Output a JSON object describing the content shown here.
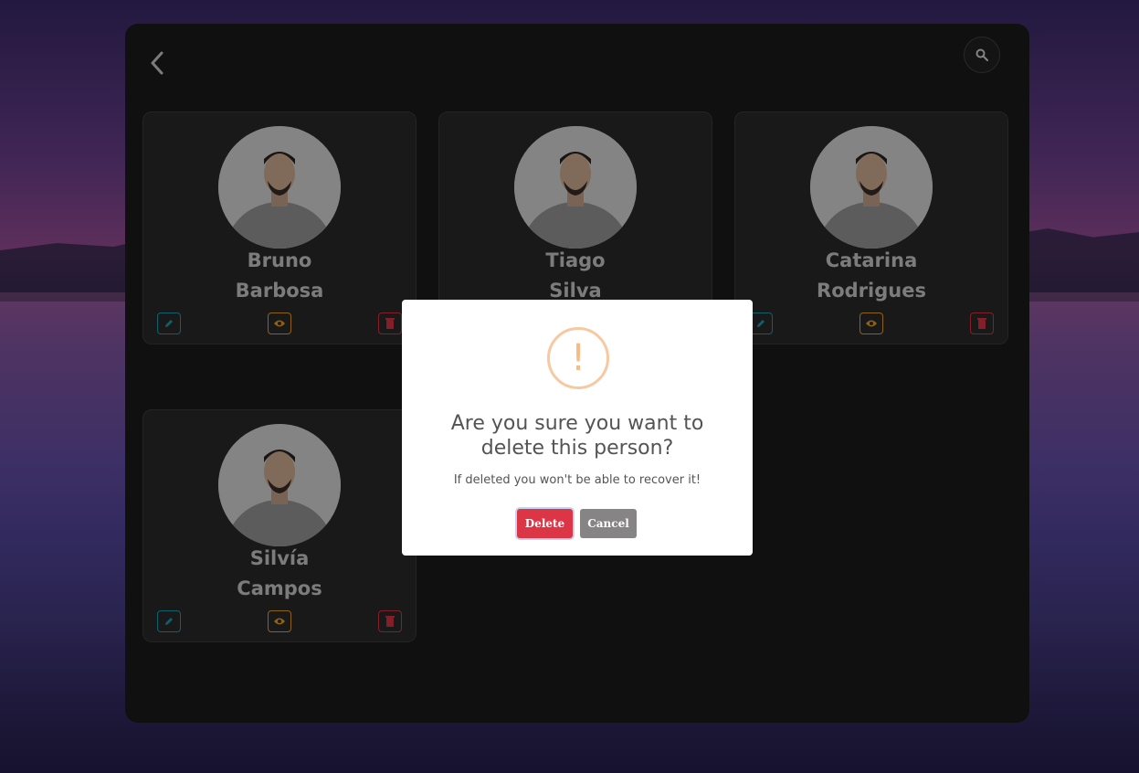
{
  "toolbar": {
    "back_icon": "chevron-left-icon",
    "search_icon": "search-icon"
  },
  "people": [
    {
      "first": "Bruno",
      "last": "Barbosa"
    },
    {
      "first": "Tiago",
      "last": "Silva"
    },
    {
      "first": "Catarina",
      "last": "Rodrigues"
    },
    {
      "first": "Silvía",
      "last": "Campos"
    }
  ],
  "actions": {
    "edit_icon": "pencil-icon",
    "view_icon": "eye-icon",
    "delete_icon": "trash-icon",
    "edit_color": "#17a2b8",
    "view_color": "#f0a020",
    "delete_color": "#dc3545"
  },
  "dialog": {
    "icon_symbol": "!",
    "title": "Are you sure you want to delete this person?",
    "text": "If deleted you won't be able to recover it!",
    "confirm_label": "Delete",
    "cancel_label": "Cancel",
    "confirm_color": "#dc3545",
    "cancel_color": "#868484"
  }
}
